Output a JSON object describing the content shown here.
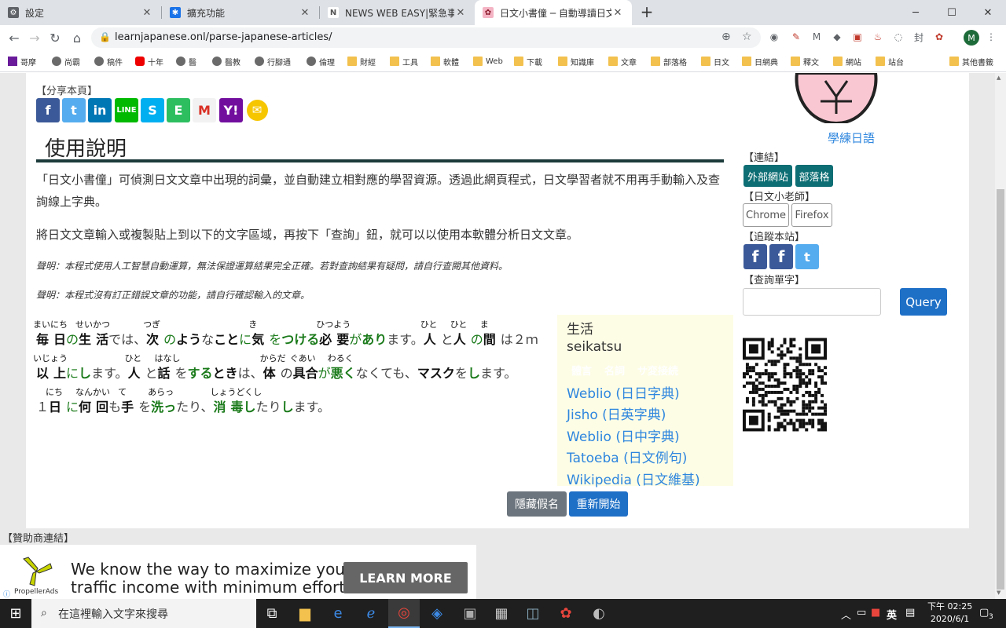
{
  "tabs": [
    {
      "title": "設定",
      "icon": "gear-icon",
      "active": false
    },
    {
      "title": "擴充功能",
      "icon": "puzzle-icon",
      "active": false
    },
    {
      "title": "NEWS WEB EASY|緊急事態宣言",
      "icon": "news-icon",
      "active": false
    },
    {
      "title": "日文小書僮 ─ 自動導讀日文短文",
      "icon": "sakura-icon",
      "active": true
    }
  ],
  "url": "learnjapanese.onl/parse-japanese-articles/",
  "avatar_letter": "M",
  "bookmarks": [
    "哥摩",
    "尚霸",
    "稿件",
    "十年",
    "醫",
    "醫教",
    "行腳通",
    "倫理",
    "財經",
    "工具",
    "軟體",
    "Web",
    "下載",
    "知識庫",
    "文章",
    "部落格",
    "日文",
    "日網典",
    "釋文",
    "網站",
    "站台",
    "其他書籤"
  ],
  "page": {
    "share_label": "【分享本頁】",
    "share_icons": [
      "facebook-icon",
      "twitter-icon",
      "linkedin-icon",
      "line-icon",
      "skype-icon",
      "evernote-icon",
      "gmail-icon",
      "yahoo-icon",
      "email-icon"
    ],
    "usage_title": "使用說明",
    "para1": "「日文小書僮」可偵測日文文章中出現的詞彙，並自動建立相對應的學習資源。透過此網頁程式，日文學習者就不用再手動輸入及查詢線上字典。",
    "para2": "將日文文章輸入或複製貼上到以下的文字區域，再按下「查詢」鈕，就可以以使用本軟體分析日文文章。",
    "note1": "聲明：本程式使用人工智慧自動運算，無法保證運算結果完全正確。若對查詢結果有疑問，請自行查閱其他資料。",
    "note2": "聲明：本程式沒有訂正錯誤文章的功能，請自行確認輸入的文章。",
    "furigana_lines": [
      [
        {
          "text": "毎",
          "ruby": "まいにち",
          "s": "k"
        },
        {
          "text": "日",
          "s": "k"
        },
        {
          "text": "の",
          "s": "p"
        },
        {
          "text": "生",
          "ruby": "せいかつ",
          "s": "k"
        },
        {
          "text": "活",
          "s": "k"
        },
        {
          "text": "では、",
          "s": "n"
        },
        {
          "text": "次",
          "ruby": "つぎ",
          "s": "k"
        },
        {
          "text": "の",
          "s": "p"
        },
        {
          "text": "よう",
          "s": "k"
        },
        {
          "text": "な",
          "s": "n"
        },
        {
          "text": "こと",
          "s": "k"
        },
        {
          "text": "に",
          "s": "p"
        },
        {
          "text": "気",
          "ruby": "き",
          "s": "k"
        },
        {
          "text": "を",
          "s": "p"
        },
        {
          "text": "つける",
          "s": "g"
        },
        {
          "text": "必",
          "ruby": "ひつよう",
          "s": "k"
        },
        {
          "text": "要",
          "s": "k"
        },
        {
          "text": "が",
          "s": "p"
        },
        {
          "text": "あり",
          "s": "g"
        },
        {
          "text": "ます。",
          "s": "n"
        },
        {
          "text": "人",
          "ruby": "ひと",
          "s": "k"
        },
        {
          "text": "と",
          "s": "n"
        },
        {
          "text": "人",
          "ruby": "ひと",
          "s": "k"
        },
        {
          "text": "の",
          "s": "p"
        },
        {
          "text": "間",
          "ruby": "ま",
          "s": "k"
        },
        {
          "text": "は２ｍ",
          "s": "n"
        }
      ],
      [
        {
          "text": "以",
          "ruby": "いじょう",
          "s": "k"
        },
        {
          "text": "上",
          "s": "k"
        },
        {
          "text": "に",
          "s": "p"
        },
        {
          "text": "し",
          "s": "g"
        },
        {
          "text": "ます。",
          "s": "n"
        },
        {
          "text": "人",
          "ruby": "ひと",
          "s": "k"
        },
        {
          "text": "と",
          "s": "n"
        },
        {
          "text": "話",
          "ruby": "はなし",
          "s": "k"
        },
        {
          "text": "を",
          "s": "n"
        },
        {
          "text": "する",
          "s": "g"
        },
        {
          "text": "とき",
          "s": "k"
        },
        {
          "text": "は、",
          "s": "n"
        },
        {
          "text": "体",
          "ruby": "からだ",
          "s": "k"
        },
        {
          "text": "の",
          "s": "n"
        },
        {
          "text": "具合",
          "ruby": "ぐあい",
          "s": "k"
        },
        {
          "text": "が",
          "s": "p"
        },
        {
          "text": "悪く",
          "ruby": "わるく",
          "s": "g"
        },
        {
          "text": "なくても、",
          "s": "n"
        },
        {
          "text": "マスク",
          "s": "k"
        },
        {
          "text": "を",
          "s": "n"
        },
        {
          "text": "し",
          "s": "g"
        },
        {
          "text": "ます。",
          "s": "n"
        }
      ],
      [
        {
          "text": "１",
          "s": "n"
        },
        {
          "text": "日",
          "ruby": "にち",
          "s": "k"
        },
        {
          "text": "に",
          "s": "p"
        },
        {
          "text": "何",
          "ruby": "なんかい",
          "s": "k"
        },
        {
          "text": "回",
          "s": "k"
        },
        {
          "text": "も",
          "s": "n"
        },
        {
          "text": "手",
          "ruby": "て",
          "s": "k"
        },
        {
          "text": "を",
          "s": "n"
        },
        {
          "text": "洗っ",
          "ruby": "あらっ",
          "s": "g"
        },
        {
          "text": "たり、",
          "s": "n"
        },
        {
          "text": "消",
          "ruby": "しょうどくし",
          "s": "g"
        },
        {
          "text": "毒",
          "s": "g"
        },
        {
          "text": "し",
          "s": "g"
        },
        {
          "text": "たり",
          "s": "n"
        },
        {
          "text": "し",
          "s": "g"
        },
        {
          "text": "ます。",
          "s": "n"
        }
      ]
    ],
    "dict": {
      "word": "生活",
      "romaji": "seikatsu",
      "tags": [
        {
          "label": "體言",
          "color": "#1e6fc6"
        },
        {
          "label": "名詞",
          "color": "#1e6fc6"
        },
        {
          "label": "サ変接続",
          "color": "#666666"
        }
      ],
      "links": [
        "Weblio (日日字典)",
        "Jisho (日英字典)",
        "Weblio (日中字典)",
        "Tatoeba (日文例句)",
        "Wikipedia (日文維基)"
      ]
    },
    "hide_kana_button": "隱藏假名",
    "restart_button": "重新開始"
  },
  "sidebar": {
    "learn_link": "學練日語",
    "links_label": "【連結】",
    "links_buttons": [
      "外部網站",
      "部落格"
    ],
    "teacher_label": "【日文小老師】",
    "teacher_buttons": [
      "Chrome",
      "Firefox"
    ],
    "follow_label": "【追蹤本站】",
    "follow_icons": [
      "facebook-icon",
      "facebook-icon",
      "twitter-icon"
    ],
    "query_label": "【查詢單字】",
    "query_placeholder": "",
    "query_button": "Query"
  },
  "ad": {
    "sponsor_label": "【贊助商連結】",
    "text_line1": "We know the way to maximize your",
    "text_line2": "traffic income with minimum efforts!",
    "button": "LEARN MORE",
    "brand": "PropellerAds"
  },
  "taskbar": {
    "search_placeholder": "在這裡輸入文字來搜尋",
    "ime": "英",
    "time": "下午 02:25",
    "date": "2020/6/1",
    "notification_count": "3"
  }
}
